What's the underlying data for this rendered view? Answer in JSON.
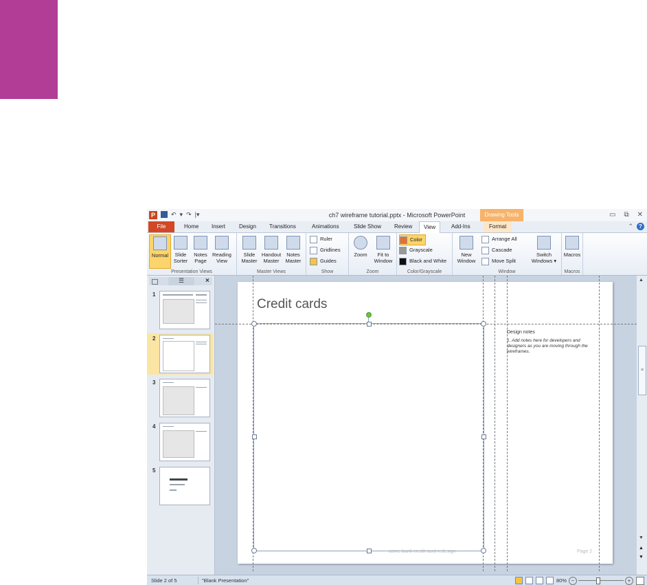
{
  "window": {
    "title": "ch7 wireframe tutorial.pptx - Microsoft PowerPoint",
    "app_logo": "P",
    "context_tab": "Drawing Tools",
    "controls": [
      "▭",
      "⧉",
      "✕"
    ],
    "help": "?",
    "ribbon_toggle": "⌃"
  },
  "qat": {
    "undo": "↶",
    "dropdown": "▾",
    "redo": "↷",
    "customize": "|▾"
  },
  "tabs": [
    "File",
    "Home",
    "Insert",
    "Design",
    "Transitions",
    "Animations",
    "Slide Show",
    "Review",
    "View",
    "Add-Ins",
    "Format"
  ],
  "ribbon": {
    "presentation_views": {
      "label": "Presentation Views",
      "normal": "Normal",
      "slide_sorter": [
        "Slide",
        "Sorter"
      ],
      "notes_page": [
        "Notes",
        "Page"
      ],
      "reading_view": [
        "Reading",
        "View"
      ]
    },
    "master_views": {
      "label": "Master Views",
      "slide_master": [
        "Slide",
        "Master"
      ],
      "handout_master": [
        "Handout",
        "Master"
      ],
      "notes_master": [
        "Notes",
        "Master"
      ]
    },
    "show": {
      "label": "Show",
      "ruler": "Ruler",
      "gridlines": "Gridlines",
      "guides": "Guides"
    },
    "zoom": {
      "label": "Zoom",
      "zoom": "Zoom",
      "fit": [
        "Fit to",
        "Window"
      ]
    },
    "color": {
      "label": "Color/Grayscale",
      "color": "Color",
      "grayscale": "Grayscale",
      "bw": "Black and White"
    },
    "window": {
      "label": "Window",
      "new_window": [
        "New",
        "Window"
      ],
      "arrange_all": "Arrange All",
      "cascade": "Cascade",
      "move_split": "Move Split",
      "switch": [
        "Switch",
        "Windows ▾"
      ]
    },
    "macros": {
      "label": "Macros",
      "macros": "Macros"
    }
  },
  "pane": {
    "close": "×",
    "slides_tab": "☰"
  },
  "slides": [
    {
      "num": "1"
    },
    {
      "num": "2"
    },
    {
      "num": "3"
    },
    {
      "num": "4"
    },
    {
      "num": "5"
    }
  ],
  "slide": {
    "title": "Credit cards",
    "notes_title": "Design notes",
    "notes_body": "1. Add notes here for developers and designers as you are moving through the wireframes.",
    "footer_left": "acme bank credit card redesign",
    "footer_right": "Page 2"
  },
  "scrollbar": {
    "up": "▲",
    "grip": "≡",
    "down": "▼",
    "page_up": "▲",
    "page_down": "▼"
  },
  "status": {
    "slide": "Slide 2 of 5",
    "theme": "\"Blank Presentation\"",
    "zoom": "80%",
    "minus": "−",
    "plus": "+"
  },
  "colors": {
    "accent": "#b23d96",
    "file_tab": "#d24726",
    "context_tab": "#f7b36a"
  }
}
